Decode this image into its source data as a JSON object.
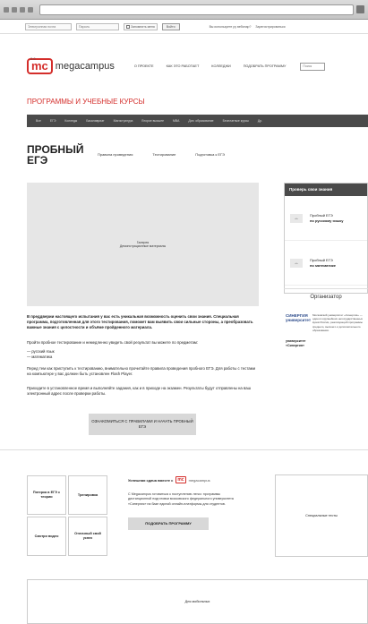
{
  "browser": {
    "url": ""
  },
  "topbar": {
    "login_placeholder": "Электронная почта",
    "password_placeholder": "Пароль",
    "remember_label": "Запомнить меня",
    "enter_label": "Войти",
    "forgot_label": "Вы используете ру вебинар?",
    "register_label": "Зарегистрироваться"
  },
  "header": {
    "logo_mark": "mc",
    "logo_sup": "2.0",
    "logo_text": "megacampus",
    "nav": [
      "О проекте",
      "Как это работает",
      "Колледжи",
      "Подобрать программу"
    ],
    "search_placeholder": "Поиск"
  },
  "section_title": "ПРОГРАММЫ И УЧЕБНЫЕ КУРСЫ",
  "category_bar": [
    "Все",
    "ЕГЭ",
    "Колледж",
    "Бакалавриат",
    "Магистратура",
    "Второе высшее",
    "MBA",
    "Доп. образование",
    "Бесплатные курсы",
    "Др."
  ],
  "page": {
    "title_line1": "ПРОБНЫЙ",
    "title_line2": "ЕГЭ",
    "subnav": [
      "Правила проведения",
      "Тестирование",
      "Подготовка к ЕГЭ"
    ]
  },
  "video": {
    "line1": "Галерея",
    "line2": "Демонстрационные материалы"
  },
  "content": {
    "para1": "В преддверии настоящего испытания у вас есть уникальная возможность оценить свои знания. Специальная программа, подготовленная для этого тестирования, поможет вам выявить свои сильные стороны, а преобразовать важные знания с целостности и объёме пройденного материала.",
    "para2": "Пройти пробное тестирование и немедленно увидеть свой результат вы можете по предметам:",
    "bullets": [
      "русский язык",
      "математика"
    ],
    "para3": "Перед тем как приступить к тестированию, внимательно прочитайте правила проведения пробного ЕГЭ. Для работы с тестами на компьютере у вас должен быть установлен Flash Player.",
    "para4": "Приходите в установленное время и выполняйте задания, как и в приходе на экзамен. Результаты будут отправлены на ваш электронный адрес после проверки работы.",
    "start_button": "ОЗНАКОМИТЬСЯ С ПРАВИЛАМИ И НАЧАТЬ ПРОБНЫЙ ЕГЭ"
  },
  "side": {
    "header": "Проверь свои знания",
    "items": [
      {
        "line1": "Пробный ЕГЭ",
        "line2": "по русскому языку"
      },
      {
        "line1": "Пробный ЕГЭ",
        "line2": "по математике"
      }
    ],
    "org_title": "Организатор",
    "org_logo": "СИНЕРГИЯ университет",
    "org_text": "Московский университет «Синергия» — один из крупнейших негосударственных вузов России, реализующий программы среднего, высшего и дополнительного образования.",
    "org_label": "университет «Синергия»"
  },
  "footer": {
    "grid": [
      "Пятерка в ЕГЭ с теории",
      "Тренировка",
      "Смотри видео",
      "Отличный свой успех"
    ],
    "about_head": "Успешная сдача вместе с",
    "about_logo": "mc",
    "about_brand": "megacampus",
    "about_text": "С Megacampus готовиться к поступлению легко: программы дистанционной подготовки московского федерального университета «Синергия» на базе единой онлайн-платформы для студентов.",
    "about_button": "ПОДОБРАТЬ ПРОГРАММУ",
    "right_box": "Специальные тесты",
    "bottom_box": "Для мобильных"
  },
  "colors": {
    "brand": "#d42e2b",
    "dark_bar": "#4a4a4a"
  }
}
